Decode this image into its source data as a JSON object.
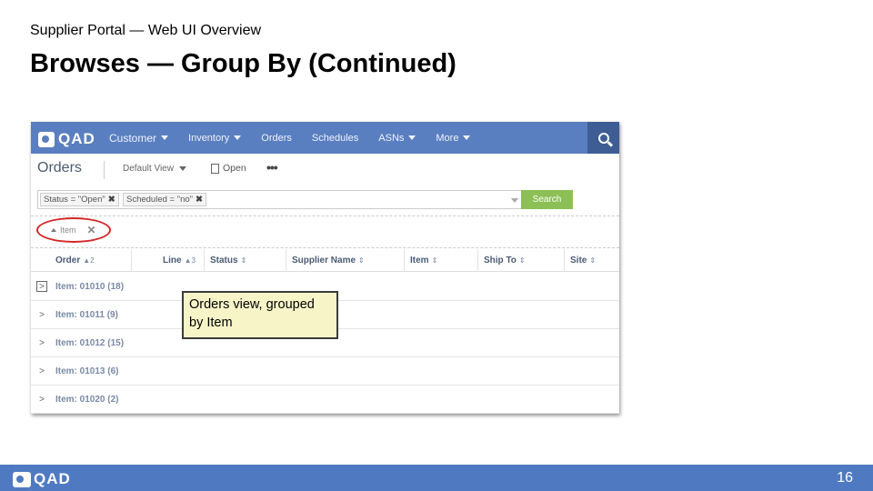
{
  "slide": {
    "subtitle": "Supplier Portal — Web UI Overview",
    "title": "Browses — Group By (Continued)",
    "page_number": "16",
    "footer_logo": "QAD"
  },
  "app": {
    "logo": "QAD",
    "nav": [
      {
        "label": "Customer",
        "has_menu": true
      },
      {
        "label": "Inventory",
        "has_menu": true
      },
      {
        "label": "Orders",
        "has_menu": false
      },
      {
        "label": "Schedules",
        "has_menu": false
      },
      {
        "label": "ASNs",
        "has_menu": true
      },
      {
        "label": "More",
        "has_menu": true
      }
    ],
    "search_icon": "search-icon",
    "page_title": "Orders",
    "view_selector": "Default View",
    "open_label": "Open",
    "more_label": "•••",
    "filters": [
      {
        "label": "Status = \"Open\""
      },
      {
        "label": "Scheduled = \"no\""
      }
    ],
    "search_button": "Search",
    "group_by": {
      "label": "Item"
    },
    "columns": [
      {
        "label": "Order",
        "sort": "▲2"
      },
      {
        "label": "Line",
        "sort": "▲3"
      },
      {
        "label": "Status",
        "sort": "⇕"
      },
      {
        "label": "Supplier Name",
        "sort": "⇕"
      },
      {
        "label": "Item",
        "sort": "⇕"
      },
      {
        "label": "Ship To",
        "sort": "⇕"
      },
      {
        "label": "Site",
        "sort": "⇕"
      }
    ],
    "groups": [
      {
        "label": "Item: 01010 (18)"
      },
      {
        "label": "Item: 01011 (9)"
      },
      {
        "label": "Item: 01012 (15)"
      },
      {
        "label": "Item: 01013 (6)"
      },
      {
        "label": "Item: 01020 (2)"
      }
    ]
  },
  "callout": {
    "text": "Orders view, grouped by Item"
  },
  "colors": {
    "nav_bar": "#5a7fc0",
    "search_button": "#8cc056",
    "highlight_oval": "#d42626",
    "callout_bg": "#f7f5c8",
    "footer_bar": "#4f7ac2"
  }
}
